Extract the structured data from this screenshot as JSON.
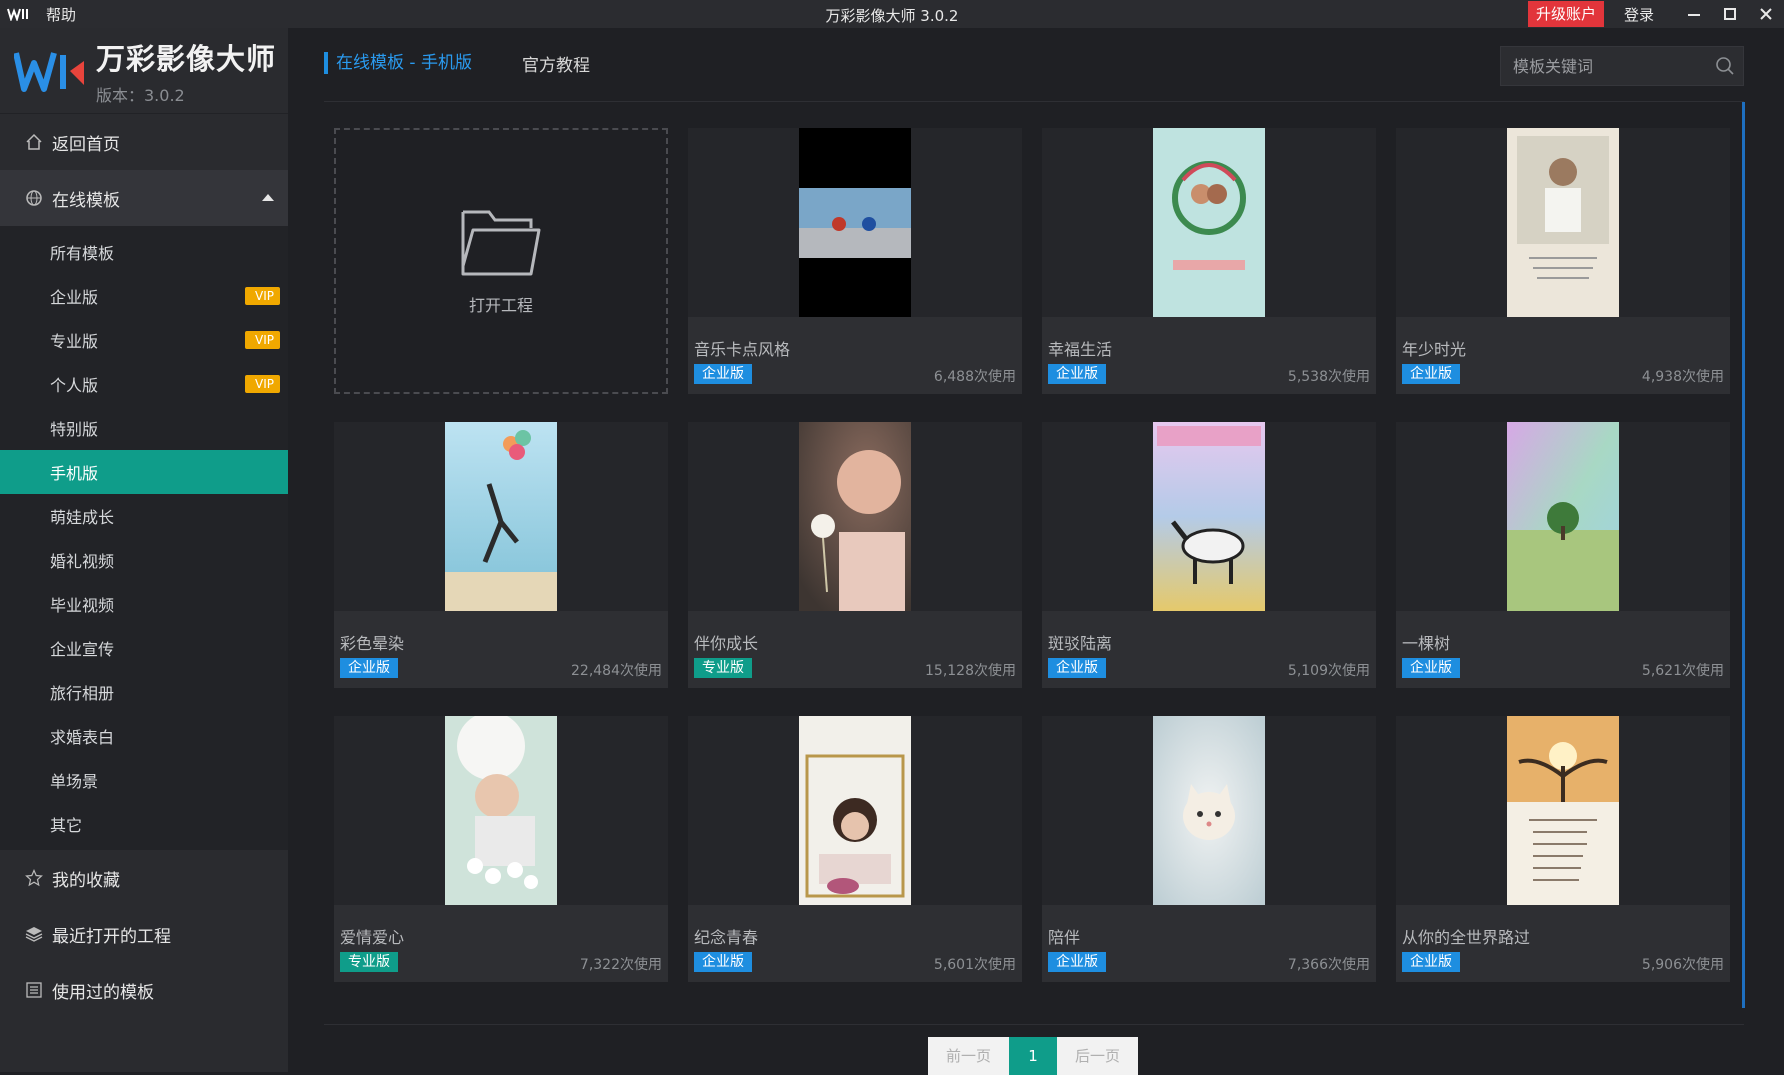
{
  "titlebar": {
    "help": "帮助",
    "title": "万彩影像大师 3.0.2",
    "upgrade": "升级账户",
    "login": "登录"
  },
  "brand": {
    "name": "万彩影像大师",
    "version": "版本：3.0.2"
  },
  "sidebar": {
    "home": "返回首页",
    "online": "在线模板",
    "items": [
      {
        "label": "所有模板"
      },
      {
        "label": "企业版",
        "vip": "VIP"
      },
      {
        "label": "专业版",
        "vip": "VIP"
      },
      {
        "label": "个人版",
        "vip": "VIP"
      },
      {
        "label": "特别版"
      },
      {
        "label": "手机版",
        "active": true
      },
      {
        "label": "萌娃成长"
      },
      {
        "label": "婚礼视频"
      },
      {
        "label": "毕业视频"
      },
      {
        "label": "企业宣传"
      },
      {
        "label": "旅行相册"
      },
      {
        "label": "求婚表白"
      },
      {
        "label": "单场景"
      },
      {
        "label": "其它"
      }
    ],
    "favorites": "我的收藏",
    "recent": "最近打开的工程",
    "used": "使用过的模板"
  },
  "main": {
    "tab_active": "在线模板 - 手机版",
    "tab_tutorial": "官方教程",
    "search_placeholder": "模板关键词",
    "open_project": "打开工程",
    "templates": [
      {
        "title": "音乐卡点风格",
        "badge": "企业版",
        "uses": "6,488次使用"
      },
      {
        "title": "幸福生活",
        "badge": "企业版",
        "uses": "5,538次使用"
      },
      {
        "title": "年少时光",
        "badge": "企业版",
        "uses": "4,938次使用"
      },
      {
        "title": "彩色晕染",
        "badge": "企业版",
        "uses": "22,484次使用"
      },
      {
        "title": "伴你成长",
        "badge": "专业版",
        "uses": "15,128次使用"
      },
      {
        "title": "斑驳陆离",
        "badge": "企业版",
        "uses": "5,109次使用"
      },
      {
        "title": "一棵树",
        "badge": "企业版",
        "uses": "5,621次使用"
      },
      {
        "title": "爱情爱心",
        "badge": "专业版",
        "uses": "7,322次使用"
      },
      {
        "title": "纪念青春",
        "badge": "企业版",
        "uses": "5,601次使用"
      },
      {
        "title": "陪伴",
        "badge": "企业版",
        "uses": "7,366次使用"
      },
      {
        "title": "从你的全世界路过",
        "badge": "企业版",
        "uses": "5,906次使用"
      }
    ]
  },
  "pager": {
    "prev": "前一页",
    "page": "1",
    "next": "后一页"
  },
  "colors": {
    "accent_teal": "#0f9d8a",
    "accent_blue": "#1e8ee0",
    "upgrade_red": "#e2353b",
    "vip_orange": "#f0a800"
  }
}
